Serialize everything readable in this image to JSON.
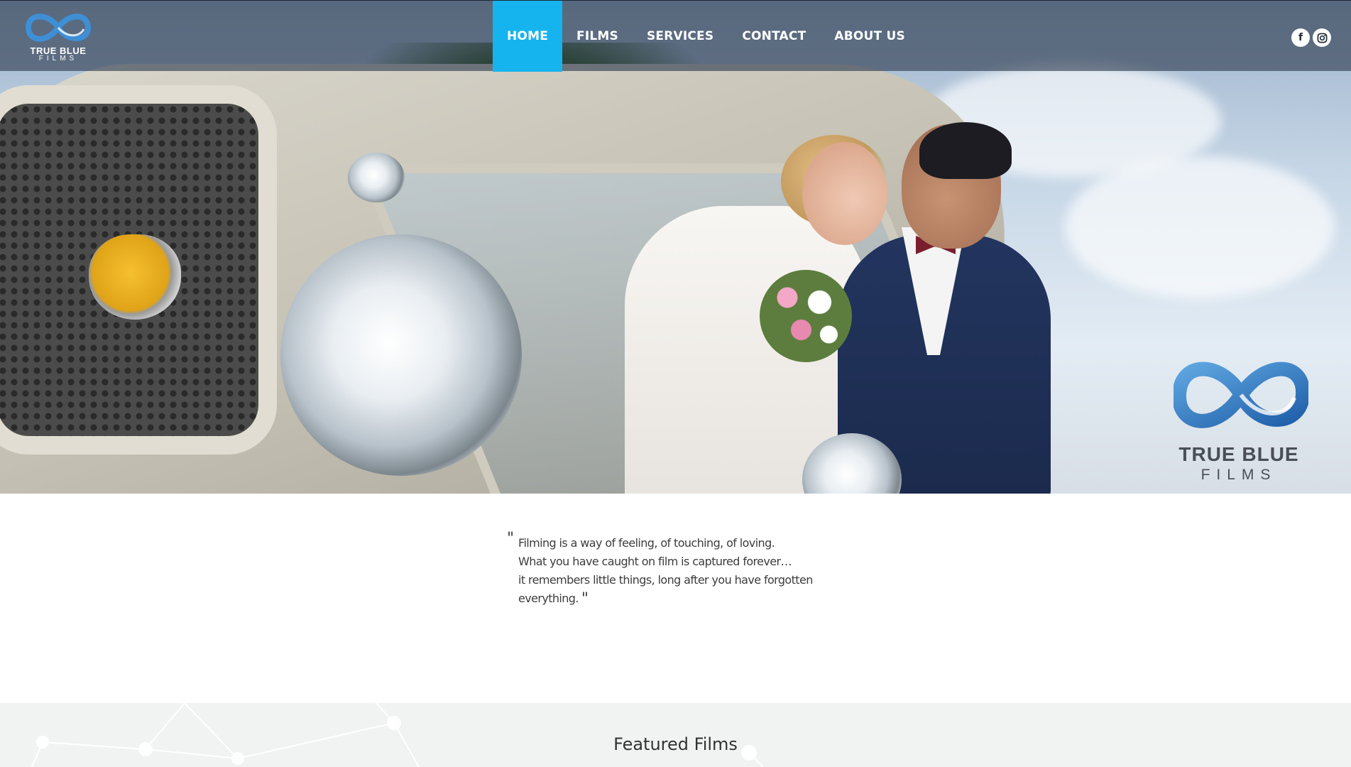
{
  "brand": {
    "name_line1": "TRUE BLUE",
    "name_line2": "FILMS"
  },
  "nav": {
    "items": [
      {
        "label": "HOME",
        "active": true
      },
      {
        "label": "FILMS",
        "active": false
      },
      {
        "label": "SERVICES",
        "active": false
      },
      {
        "label": "CONTACT",
        "active": false
      },
      {
        "label": "ABOUT US",
        "active": false
      }
    ],
    "active_color": "#16b4ef",
    "social": [
      {
        "icon": "facebook-icon",
        "glyph": "f"
      },
      {
        "icon": "instagram-icon"
      }
    ]
  },
  "hero": {
    "logo_line1": "TRUE BLUE",
    "logo_line2": "FILMS",
    "image_description_icon": "wedding-photo"
  },
  "quote": {
    "open_mark": "\"",
    "lines": [
      "Filming is a way of feeling, of touching, of loving.",
      "What you have caught on film is captured forever…",
      "it remembers little things, long after you have forgotten everything."
    ],
    "close_mark": "\""
  },
  "featured": {
    "title": "Featured Films"
  }
}
